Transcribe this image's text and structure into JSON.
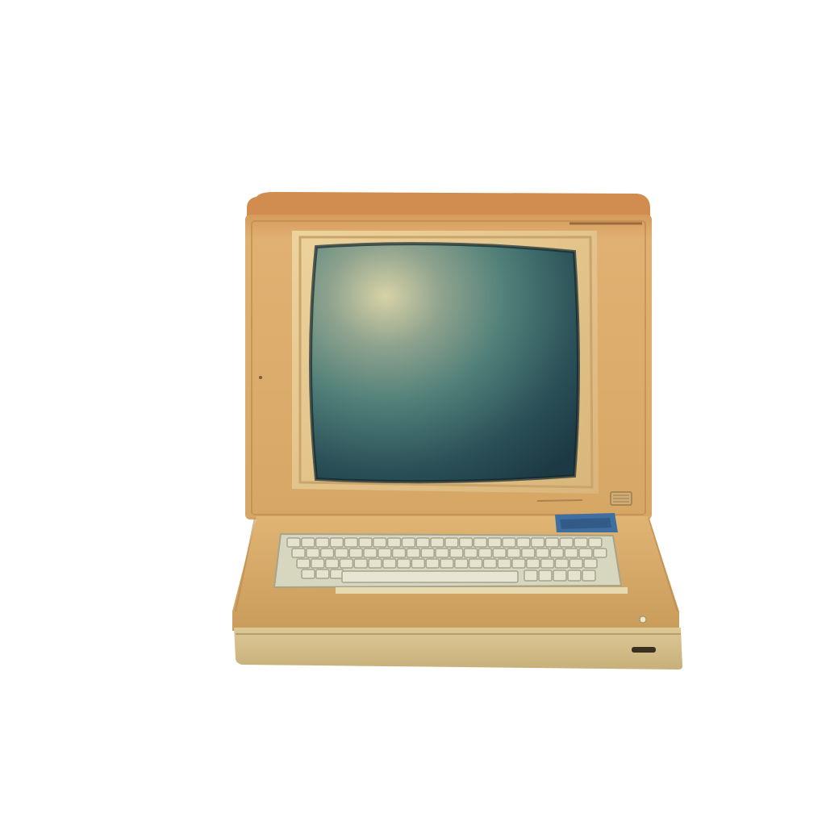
{
  "scene": {
    "subject_icon": "retro-computer-icon",
    "colors": {
      "background": "#ffffff",
      "case_top": "#d08d4f",
      "case_body": "#ddb06c",
      "case_shadow": "#b9874d",
      "bezel": "#e7c88e",
      "bezel_inner": "#caa46a",
      "screen_dark": "#1d3a44",
      "screen_mid": "#4f7f78",
      "screen_glare": "#d7d2a6",
      "keyboard_base": "#d7d6bf",
      "keys": "#e5e3cd",
      "key_shadow": "#a6a48d",
      "base_front": "#d8c28e",
      "cartridge": "#3f6ea1"
    }
  }
}
